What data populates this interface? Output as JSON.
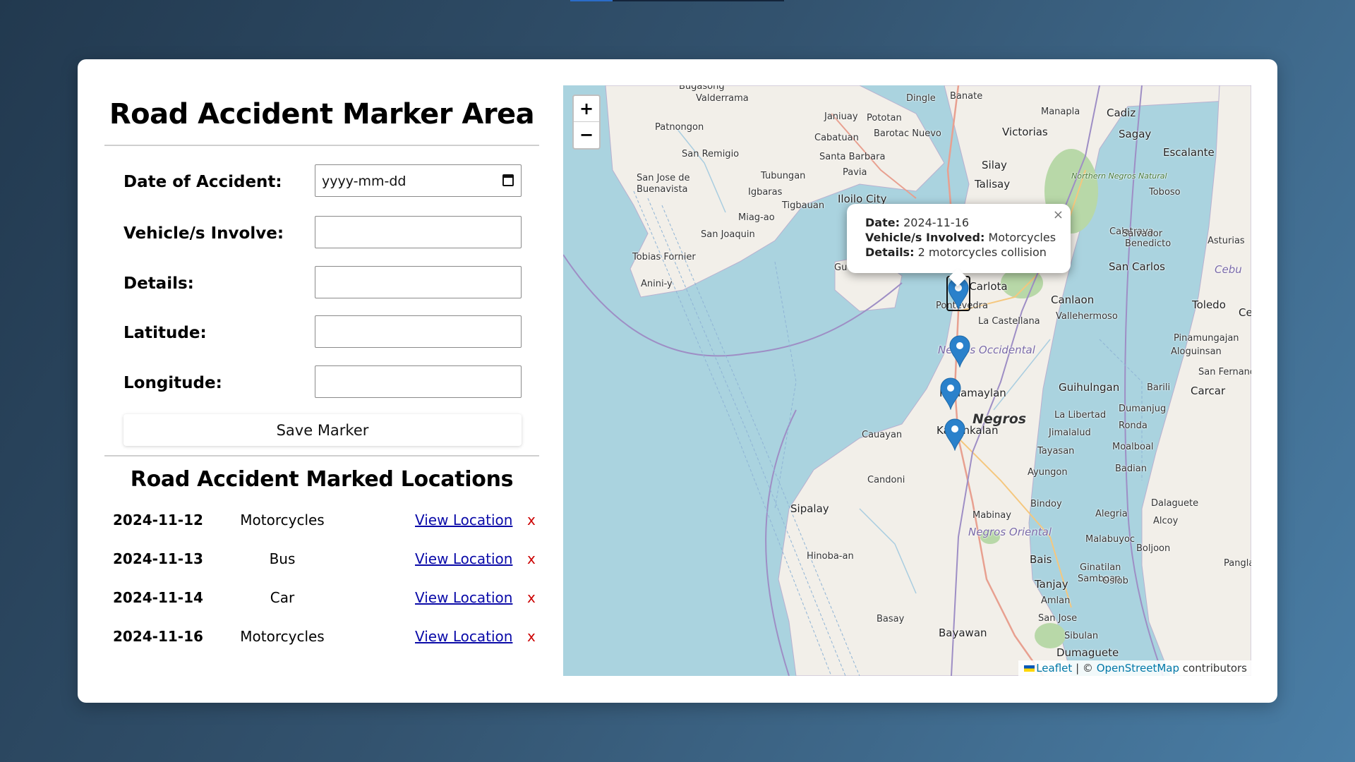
{
  "form": {
    "title": "Road Accident Marker Area",
    "date_label": "Date of Accident:",
    "date_placeholder": "yyyy-mm-dd",
    "vehicle_label": "Vehicle/s Involve:",
    "details_label": "Details:",
    "latitude_label": "Latitude:",
    "longitude_label": "Longitude:",
    "save_button": "Save Marker"
  },
  "locations": {
    "title": "Road Accident Marked Locations",
    "link_label": "View Location",
    "delete_label": "x",
    "rows": [
      {
        "date": "2024-11-12",
        "vehicle": "Motorcycles"
      },
      {
        "date": "2024-11-13",
        "vehicle": "Bus"
      },
      {
        "date": "2024-11-14",
        "vehicle": "Car"
      },
      {
        "date": "2024-11-16",
        "vehicle": "Motorcycles"
      }
    ]
  },
  "map": {
    "zoom_in": "+",
    "zoom_out": "−",
    "popup": {
      "date_label": "Date:",
      "date": "2024-11-16",
      "vehicle_label": "Vehicle/s Involved:",
      "vehicle": "Motorcycles",
      "details_label": "Details:",
      "details": "2 motorcycles collision",
      "close": "×"
    },
    "attribution": {
      "leaflet": "Leaflet",
      "sep": "| ©",
      "osm": "OpenStreetMap",
      "suffix": "contributors"
    },
    "places": {
      "p1": "Bugasong",
      "p2": "Valderrama",
      "p3": "Patnongon",
      "p4": "San Remigio",
      "p5": "San Jose de",
      "p6": "Buenavista",
      "p7": "Janiuay",
      "p8": "Pototan",
      "p9": "Dingle",
      "p10": "Banate",
      "p11": "Barotac Nuevo",
      "p12": "Cabatuan",
      "p13": "Santa Barbara",
      "p14": "Pavia",
      "p15": "Tubungan",
      "p16": "Igbaras",
      "p17": "Tigbauan",
      "p18": "Iloilo City",
      "p19": "Miag-ao",
      "p20": "San Joaquin",
      "p21": "Tobias Fornier",
      "p22": "Anini-y",
      "p23": "Manapla",
      "p24": "Cadiz",
      "p25": "Victorias",
      "p26": "Sagay",
      "p27": "Escalante",
      "p28": "Silay",
      "p29": "Talisay",
      "p30": "Toboso",
      "p31": "Calatrava",
      "p32": "Asturias",
      "p33": "San Carlos",
      "p34": "Cebu",
      "p35": "Toledo",
      "p36": "Canlaon",
      "p37": "Vallehermoso",
      "p38": "Pinamungajan",
      "p39": "Aloguinsan",
      "p40": "Guihulngan",
      "p41": "San Fernand",
      "p42": "Barili",
      "p43": "Carcar",
      "p44": "Dumanjug",
      "p45": "La Libertad",
      "p46": "Jimalalud",
      "p47": "Ronda",
      "p48": "Moalboal",
      "p49": "Tayasan",
      "p50": "Badian",
      "p51": "Ayungon",
      "p52": "Bindoy",
      "p53": "Dalaguete",
      "p54": "Alegria",
      "p55": "Alcoy",
      "p56": "Mabinay",
      "p57": "Malabuyoc",
      "p58": "Boljoon",
      "p59": "Bais",
      "p60": "Ginatilan",
      "p61": "Samboan",
      "p62": "Oslob",
      "p63": "Tanjay",
      "p64": "Amlan",
      "p65": "San Jose",
      "p66": "Sibulan",
      "p67": "Dumaguete",
      "p68": "Bayawan",
      "p69": "Basay",
      "p70": "Hinoba-an",
      "p71": "Sipalay",
      "p72": "Candoni",
      "p73": "Cauayan",
      "p74": "Kabankalan",
      "p75": "Himamaylan",
      "p76": "La Castellana",
      "p77": "La Carlota",
      "p78": "Pontevedra",
      "p79": "Negros",
      "p80": "Negros Occidental",
      "p81": "Negros Oriental",
      "p82": "Northern Negros Natural",
      "p83": "Salvador",
      "p84": "Benedicto",
      "p85": "Pangla",
      "p86": "Ce",
      "p87": "Gu"
    }
  }
}
